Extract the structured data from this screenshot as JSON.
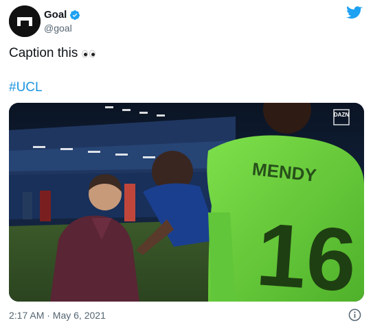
{
  "account": {
    "display_name": "Goal",
    "handle": "@goal",
    "verified": true
  },
  "tweet": {
    "text": "Caption this",
    "emoji": "eyes",
    "hashtag": "#UCL",
    "timestamp": "2:17 AM · May 6, 2021"
  },
  "media": {
    "broadcaster_logo": "DAZN",
    "jersey_name": "MENDY",
    "jersey_number": "16"
  },
  "colors": {
    "link": "#1b95e0",
    "secondary_text": "#536471",
    "twitter_blue": "#1da1f2",
    "jersey_green": "#6bd13a"
  },
  "icons": {
    "brand": "twitter-bird-icon",
    "verified": "verified-badge-icon",
    "info": "info-icon"
  }
}
